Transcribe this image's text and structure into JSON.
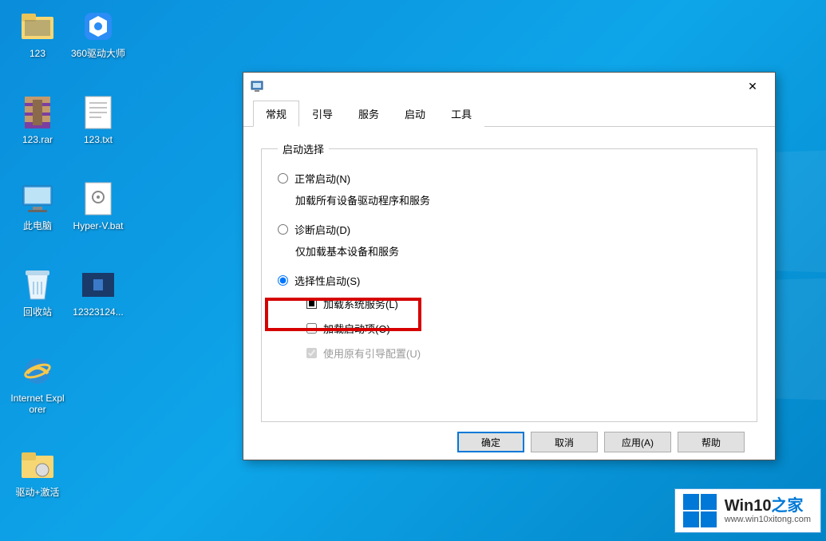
{
  "desktop": {
    "icons": [
      {
        "label": "123"
      },
      {
        "label": "360驱动大师"
      },
      {
        "label": "123.rar"
      },
      {
        "label": "123.txt"
      },
      {
        "label": "此电脑"
      },
      {
        "label": "Hyper-V.bat"
      },
      {
        "label": "回收站"
      },
      {
        "label": "12323124..."
      },
      {
        "label": "Internet Explorer"
      },
      {
        "label": "驱动+激活"
      }
    ]
  },
  "dialog": {
    "tabs": {
      "general": "常规",
      "boot": "引导",
      "services": "服务",
      "startup": "启动",
      "tools": "工具"
    },
    "group_title": "启动选择",
    "radios": {
      "normal": "正常启动(N)",
      "normal_sub": "加载所有设备驱动程序和服务",
      "diagnostic": "诊断启动(D)",
      "diagnostic_sub": "仅加载基本设备和服务",
      "selective": "选择性启动(S)"
    },
    "checks": {
      "load_services": "加载系统服务(L)",
      "load_startup": "加载启动项(O)",
      "use_original_boot": "使用原有引导配置(U)"
    },
    "buttons": {
      "ok": "确定",
      "cancel": "取消",
      "apply": "应用(A)",
      "help": "帮助"
    }
  },
  "watermark": {
    "title_prefix": "Win10",
    "title_suffix": "之家",
    "url": "www.win10xitong.com"
  },
  "colors": {
    "highlight": "#d60000"
  }
}
